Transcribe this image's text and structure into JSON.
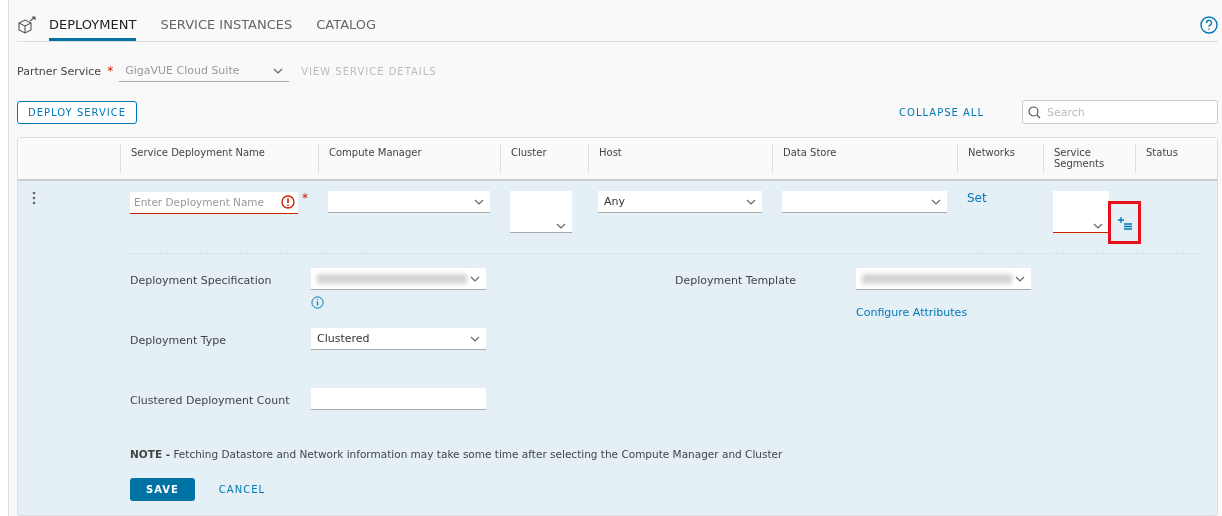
{
  "tabs": [
    {
      "label": "DEPLOYMENT",
      "selected": true
    },
    {
      "label": "SERVICE INSTANCES",
      "selected": false
    },
    {
      "label": "CATALOG",
      "selected": false
    }
  ],
  "partner": {
    "label": "Partner Service",
    "required_mark": "*",
    "value": "GigaVUE Cloud Suite",
    "disabled": true,
    "link": "VIEW SERVICE DETAILS"
  },
  "toolbar": {
    "deploy": "DEPLOY SERVICE",
    "collapse": "COLLAPSE ALL",
    "search_placeholder": "Search"
  },
  "table": {
    "columns": [
      "Service Deployment Name",
      "Compute Manager",
      "Cluster",
      "Host",
      "Data Store",
      "Networks",
      "Service Segments",
      "Status"
    ],
    "row": {
      "name": {
        "placeholder": "Enter Deployment Name",
        "error": true,
        "required_mark": "*"
      },
      "host": "Any",
      "networks": "Set",
      "segments": {
        "error": true,
        "highlighted": true
      }
    },
    "details": {
      "left": [
        {
          "kind": "select",
          "label": "Deployment Specification",
          "redacted": true,
          "info": true
        },
        {
          "kind": "select",
          "label": "Deployment Type",
          "value": "Clustered"
        },
        {
          "kind": "input",
          "label": "Clustered Deployment Count"
        }
      ],
      "right": [
        {
          "kind": "select",
          "label": "Deployment Template",
          "redacted": true
        },
        {
          "kind": "link",
          "label": "Configure Attributes"
        }
      ],
      "note": "**NOTE -** Fetching Datastore and Network information may take some time after selecting the Compute Manager and Cluster",
      "save": "SAVE",
      "cancel": "CANCEL"
    }
  }
}
